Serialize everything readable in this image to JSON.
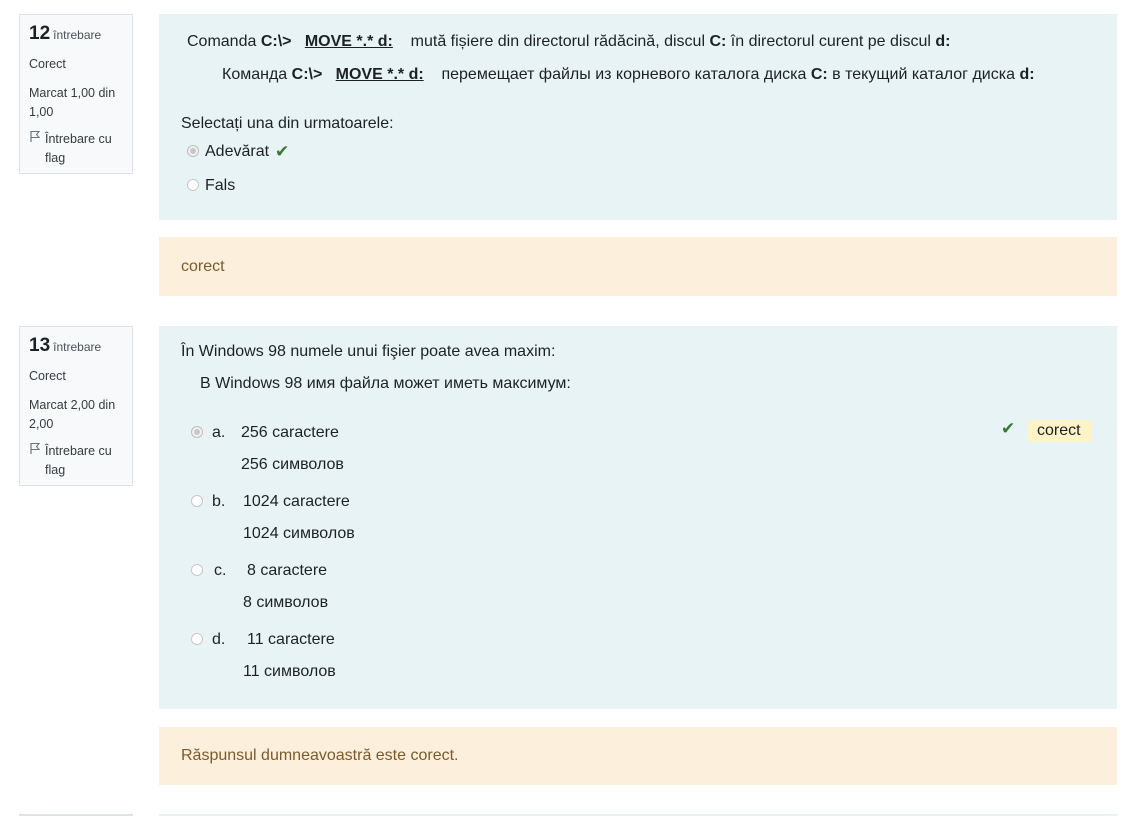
{
  "q12": {
    "number": "12",
    "word": "întrebare",
    "state": "Corect",
    "mark": "Marcat 1,00 din 1,00",
    "flag": "Întrebare cu flag",
    "ro": {
      "pre": "Comanda ",
      "path": "C:\\>",
      "cmd": "MOVE *.* d:",
      "mid": "mută fișiere din directorul rădăcină, discul ",
      "drive": "C:",
      "post": " în directorul curent pe discul ",
      "dest": "d:"
    },
    "ru": {
      "pre": "Команда ",
      "path": "C:\\>",
      "cmd": "MOVE *.* d:",
      "mid": "перемещает файлы из корневого каталога диска ",
      "drive": "C:",
      "post": " в текущий каталог диска ",
      "dest": "d:"
    },
    "prompt": "Selectați una din urmatoarele:",
    "options": [
      "Adevărat",
      "Fals"
    ],
    "feedback": "corect"
  },
  "q13": {
    "number": "13",
    "word": "întrebare",
    "state": "Corect",
    "mark": "Marcat 2,00 din 2,00",
    "flag": "Întrebare cu flag",
    "text_ro": "În Windows 98 numele unui fişier poate avea maxim:",
    "text_ru": "В Windows 98 имя файла может иметь максимум:",
    "options": [
      {
        "letter": "a.",
        "ro": "256 caractere",
        "ru": "256 символов"
      },
      {
        "letter": "b.",
        "ro": "1024 caractere",
        "ru": "1024 символов"
      },
      {
        "letter": "c.",
        "ro": "8 caractere",
        "ru": "8 символов"
      },
      {
        "letter": "d.",
        "ro": "11 caractere",
        "ru": "11 символов"
      }
    ],
    "correct_badge": "corect",
    "feedback": "Răspunsul dumneavoastră este corect."
  },
  "colors": {
    "formulation_bg": "#e7f3f5",
    "feedback_bg": "#fcefdc",
    "feedback_text": "#7d5a29",
    "check_green": "#357a32",
    "badge_bg": "#fcf4c7"
  },
  "icons": {
    "flag": "flag-icon",
    "check": "check-icon"
  }
}
